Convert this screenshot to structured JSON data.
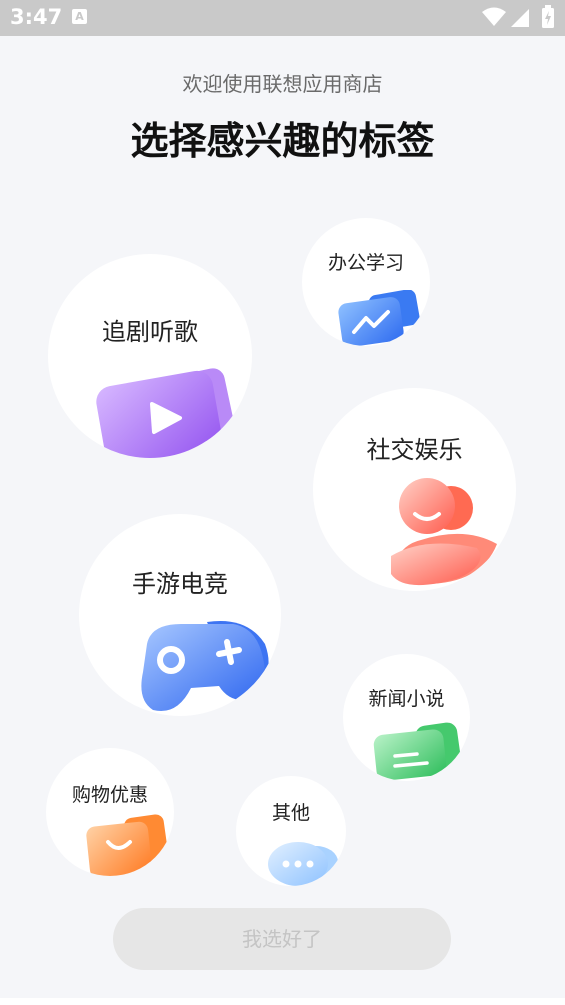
{
  "status_bar": {
    "time": "3:47",
    "notification_icon": "A"
  },
  "header": {
    "welcome": "欢迎使用联想应用商店",
    "title": "选择感兴趣的标签"
  },
  "tags": {
    "office": "办公学习",
    "drama_music": "追剧听歌",
    "social": "社交娱乐",
    "games": "手游电竞",
    "news": "新闻小说",
    "shopping": "购物优惠",
    "other": "其他"
  },
  "confirm_button": "我选好了",
  "colors": {
    "status_bar": "#c9c9c9",
    "background": "#f5f6f9",
    "bubble": "#ffffff",
    "purple": "#a66cf2",
    "blue": "#3d7bf5",
    "red": "#ff6a5c",
    "green": "#3ecb6a",
    "orange": "#ff8a2a",
    "light_blue": "#9cc9ff",
    "button_bg": "#e6e6e6",
    "button_text": "#c4c4c4"
  }
}
